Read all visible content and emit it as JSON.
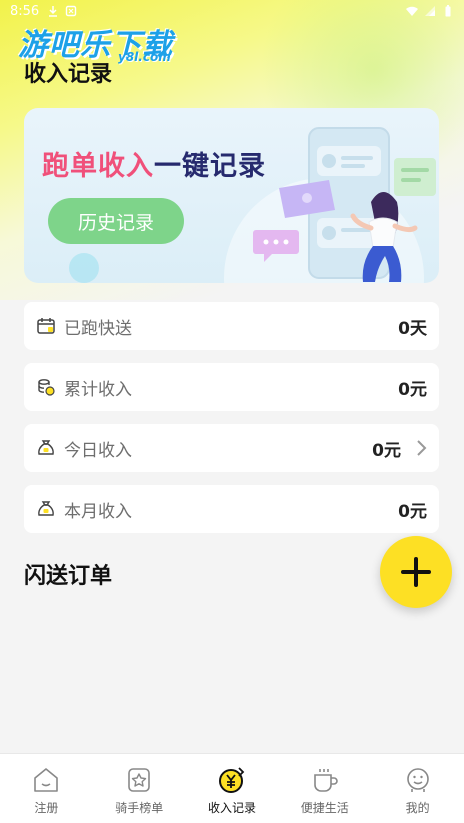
{
  "status_bar": {
    "time": "8:56"
  },
  "watermark": {
    "text": "游吧乐下载",
    "sub": "y8l.com"
  },
  "page": {
    "title": "收入记录"
  },
  "banner": {
    "headline_part1": "跑单收入",
    "headline_part2": "一键记录",
    "history_button": "历史记录"
  },
  "stats": [
    {
      "label": "已跑快送",
      "value": "0天",
      "icon": "calendar-icon"
    },
    {
      "label": "累计收入",
      "value": "0元",
      "icon": "coins-icon"
    },
    {
      "label": "今日收入",
      "value": "0元",
      "icon": "money-bag-icon",
      "has_chevron": true
    },
    {
      "label": "本月收入",
      "value": "0元",
      "icon": "money-bag-icon"
    }
  ],
  "section": {
    "title": "闪送订单"
  },
  "fab": {
    "icon": "plus-icon"
  },
  "tabs": [
    {
      "label": "注册",
      "icon": "home-icon"
    },
    {
      "label": "骑手榜单",
      "icon": "star-badge-icon"
    },
    {
      "label": "收入记录",
      "icon": "yen-coin-icon",
      "active": true
    },
    {
      "label": "便捷生活",
      "icon": "cup-icon"
    },
    {
      "label": "我的",
      "icon": "profile-icon"
    }
  ],
  "colors": {
    "accent_yellow": "#fde024",
    "headline_pink": "#f0507a",
    "headline_navy": "#262a6e",
    "history_green": "#7ed48a"
  }
}
